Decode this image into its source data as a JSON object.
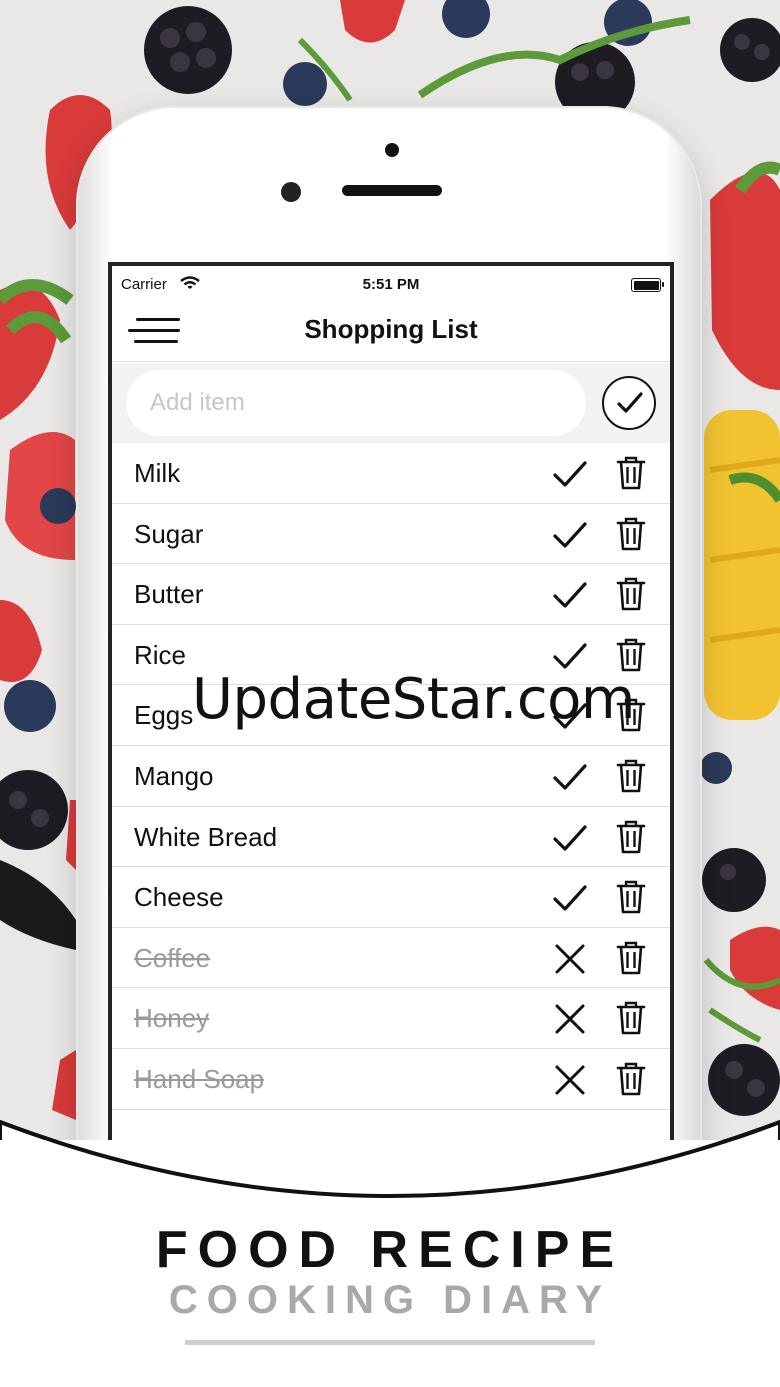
{
  "status_bar": {
    "carrier": "Carrier",
    "time": "5:51 PM"
  },
  "header": {
    "title": "Shopping List"
  },
  "add_item": {
    "placeholder": "Add item"
  },
  "items": [
    {
      "name": "Milk",
      "done": false
    },
    {
      "name": "Sugar",
      "done": false
    },
    {
      "name": "Butter",
      "done": false
    },
    {
      "name": "Rice",
      "done": false
    },
    {
      "name": "Eggs",
      "done": false
    },
    {
      "name": "Mango",
      "done": false
    },
    {
      "name": "White Bread",
      "done": false
    },
    {
      "name": "Cheese",
      "done": false
    },
    {
      "name": "Coffee",
      "done": true
    },
    {
      "name": "Honey",
      "done": true
    },
    {
      "name": "Hand Soap",
      "done": true
    }
  ],
  "watermark": "UpdateStar.com",
  "branding": {
    "line1": "FOOD RECIPE",
    "line2": "COOKING DIARY"
  },
  "colors": {
    "accent": "#111111",
    "muted": "#a9a9a9",
    "strawberry": "#d93a3a",
    "mango": "#f2c230"
  }
}
